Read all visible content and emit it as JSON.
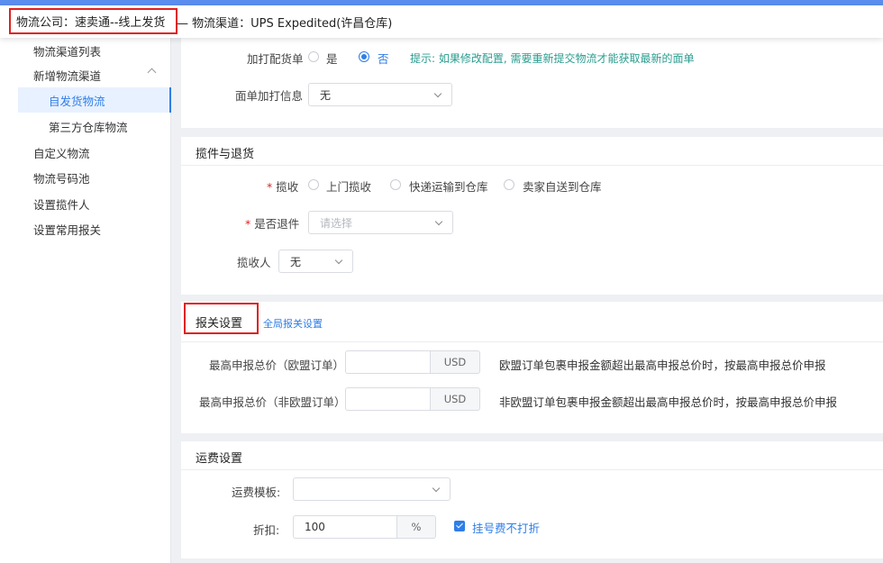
{
  "header": {
    "company_label": "物流公司：速卖通--线上发货",
    "channel_label": "— 物流渠道：UPS Expedited(许昌仓库)"
  },
  "sidebar": {
    "items": [
      {
        "label": "物流渠道列表"
      },
      {
        "label": "新增物流渠道"
      },
      {
        "label": "自发货物流"
      },
      {
        "label": "第三方仓库物流"
      },
      {
        "label": "自定义物流"
      },
      {
        "label": "物流号码池"
      },
      {
        "label": "设置揽件人"
      },
      {
        "label": "设置常用报关"
      }
    ]
  },
  "print_section": {
    "extra_print": {
      "label": "加打配货单",
      "yes": "是",
      "no": "否",
      "selected": "否"
    },
    "hint": "提示: 如果修改配置, 需要重新提交物流才能获取最新的面单",
    "face_info": {
      "label": "面单加打信息",
      "value": "无"
    }
  },
  "pickup_section": {
    "title": "揽件与退货",
    "pickup": {
      "label": "揽收",
      "options": [
        "上门揽收",
        "快递运输到仓库",
        "卖家自送到仓库"
      ]
    },
    "returnable": {
      "label": "是否退件",
      "placeholder": "请选择"
    },
    "collector": {
      "label": "揽收人",
      "value": "无"
    }
  },
  "customs_section": {
    "title": "报关设置",
    "global_link": "全局报关设置",
    "eu": {
      "label": "最高申报总价（欧盟订单）",
      "unit": "USD",
      "value": "",
      "desc": "欧盟订单包裹申报金额超出最高申报总价时，按最高申报总价申报"
    },
    "non_eu": {
      "label": "最高申报总价（非欧盟订单）",
      "unit": "USD",
      "value": "",
      "desc": "非欧盟订单包裹申报金额超出最高申报总价时，按最高申报总价申报"
    }
  },
  "freight_section": {
    "title": "运费设置",
    "template": {
      "label": "运费模板:",
      "value": ""
    },
    "discount": {
      "label": "折扣:",
      "value": "100",
      "unit": "%"
    },
    "no_discount_reg": {
      "label": "挂号费不打折",
      "checked": true
    }
  },
  "colors": {
    "accent": "#2f7ee8",
    "highlight": "#e02020",
    "hint": "#2a9d8f"
  }
}
